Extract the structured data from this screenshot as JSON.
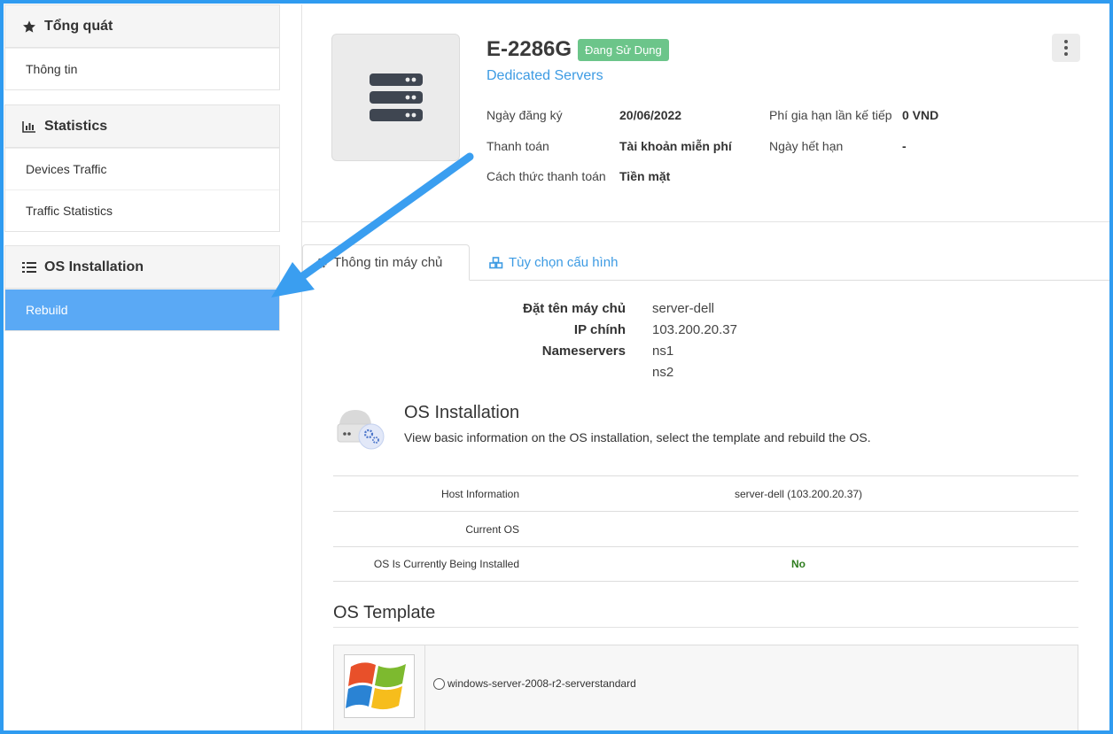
{
  "sidebar": {
    "overview": {
      "title": "Tổng quát",
      "items": [
        "Thông tin"
      ]
    },
    "statistics": {
      "title": "Statistics",
      "items": [
        "Devices Traffic",
        "Traffic Statistics"
      ]
    },
    "os_installation": {
      "title": "OS Installation",
      "items": [
        "Rebuild"
      ]
    }
  },
  "product": {
    "name": "E-2286G",
    "status": "Đang Sử Dụng",
    "group": "Dedicated Servers",
    "registered_label": "Ngày đăng ký",
    "registered_value": "20/06/2022",
    "payment_label": "Thanh toán",
    "payment_value": "Tài khoản miễn phí",
    "method_label": "Cách thức thanh toán",
    "method_value": "Tiền mặt",
    "renewal_label": "Phí gia hạn lần kế tiếp",
    "renewal_value": "0 VND",
    "expiry_label": "Ngày hết hạn",
    "expiry_value": "-"
  },
  "tabs": [
    "Thông tin máy chủ",
    "Tùy chọn cấu hình"
  ],
  "details": {
    "hostname_label": "Đặt tên máy chủ",
    "hostname_value": "server-dell",
    "ip_label": "IP chính",
    "ip_value": "103.200.20.37",
    "ns_label": "Nameservers",
    "ns_values": [
      "ns1",
      "ns2"
    ]
  },
  "os_install": {
    "title": "OS Installation",
    "description": "View basic information on the OS installation, select the template and rebuild the OS.",
    "rows": [
      {
        "label": "Host Information",
        "value": "server-dell (103.200.20.37)"
      },
      {
        "label": "Current OS",
        "value": ""
      },
      {
        "label": "OS Is Currently Being Installed",
        "value": "No"
      }
    ]
  },
  "os_template": {
    "title": "OS Template",
    "options": [
      "windows-server-2008-r2-serverstandard"
    ]
  },
  "colors": {
    "accent": "#5aa9f5",
    "link": "#3d9be3",
    "badge": "#6cc58a",
    "annotation_arrow": "#3a9ef0"
  }
}
